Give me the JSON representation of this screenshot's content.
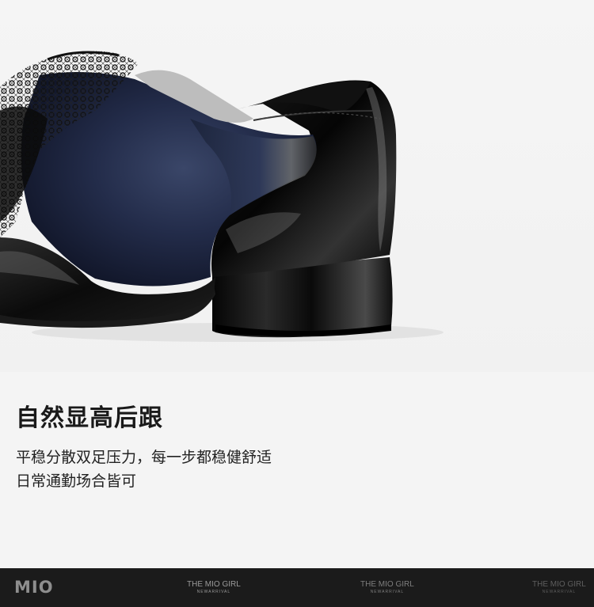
{
  "headline": "自然显高后跟",
  "body_lines": [
    "平稳分散双足压力，每一步都稳健舒适",
    "日常通勤场合皆可"
  ],
  "footer": {
    "logo": "MIO",
    "tags": [
      {
        "title": "THE MIO GIRL",
        "subtitle": "NEWARRIVAL"
      },
      {
        "title": "THE MIO GIRL",
        "subtitle": "NEWARRIVAL"
      },
      {
        "title": "THE MIO GIRL",
        "subtitle": "NEWARRIVAL"
      }
    ]
  },
  "colors": {
    "background": "#f4f4f4",
    "footer_bg": "#1b1b1b",
    "patent_black": "#0c0c0c",
    "satin_navy": "#1c2540"
  }
}
